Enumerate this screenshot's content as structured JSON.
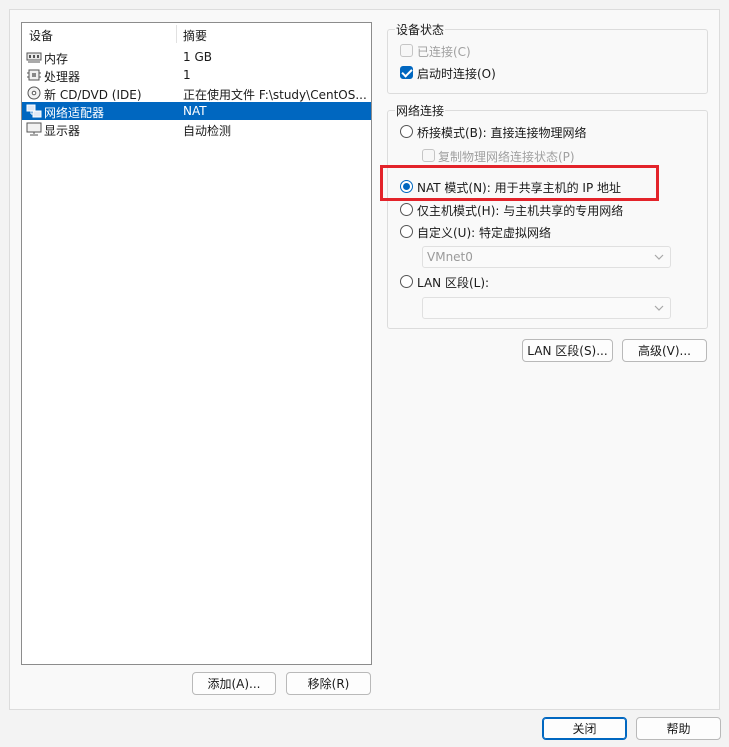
{
  "device_list": {
    "header": {
      "device": "设备",
      "summary": "摘要"
    },
    "rows": [
      {
        "icon": "memory-icon",
        "name": "内存",
        "summary": "1 GB",
        "selected": false
      },
      {
        "icon": "processor-icon",
        "name": "处理器",
        "summary": "1",
        "selected": false
      },
      {
        "icon": "cd-dvd-icon",
        "name": "新 CD/DVD (IDE)",
        "summary": "正在使用文件 F:\\study\\CentOS...",
        "selected": false
      },
      {
        "icon": "network-adapter-icon",
        "name": "网络适配器",
        "summary": "NAT",
        "selected": true
      },
      {
        "icon": "display-icon",
        "name": "显示器",
        "summary": "自动检测",
        "selected": false
      }
    ]
  },
  "buttons": {
    "add": "添加(A)...",
    "remove": "移除(R)",
    "lan_segment": "LAN 区段(S)...",
    "advanced": "高级(V)...",
    "close": "关闭",
    "help": "帮助"
  },
  "device_status": {
    "title": "设备状态",
    "connected": {
      "label": "已连接(C)",
      "checked": false,
      "enabled": false
    },
    "connect_at_power_on": {
      "label": "启动时连接(O)",
      "checked": true,
      "enabled": true
    }
  },
  "network_connection": {
    "title": "网络连接",
    "bridged": {
      "label": "桥接模式(B): 直接连接物理网络",
      "checked": false
    },
    "replicate_state": {
      "label": "复制物理网络连接状态(P)",
      "checked": false,
      "enabled": false
    },
    "nat": {
      "label": "NAT 模式(N): 用于共享主机的 IP 地址",
      "checked": true
    },
    "host_only": {
      "label": "仅主机模式(H): 与主机共享的专用网络",
      "checked": false
    },
    "custom": {
      "label": "自定义(U): 特定虚拟网络",
      "checked": false
    },
    "custom_select": {
      "value": "VMnet0"
    },
    "lan_segment": {
      "label": "LAN 区段(L):",
      "checked": false
    },
    "lan_select": {
      "value": ""
    }
  },
  "colors": {
    "accent": "#0067c0",
    "highlight_box": "#e3232a"
  }
}
